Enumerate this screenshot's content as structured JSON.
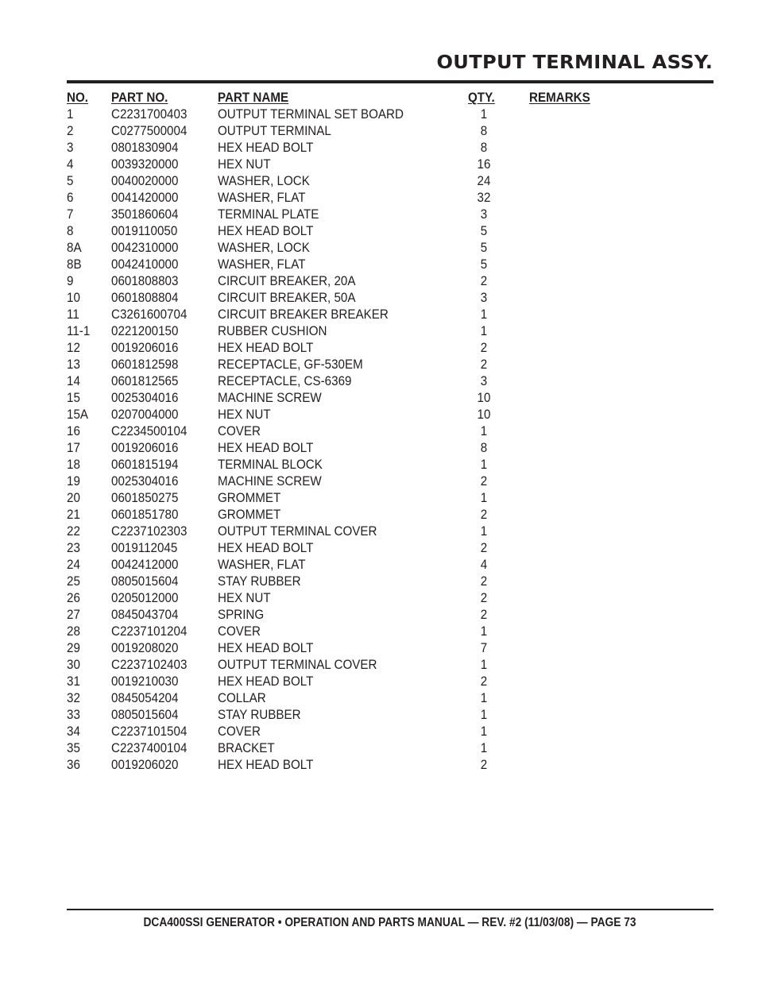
{
  "page": {
    "title": "OUTPUT TERMINAL ASSY.",
    "footer": "DCA400SSI GENERATOR • OPERATION AND PARTS MANUAL — REV. #2 (11/03/08) — PAGE 73"
  },
  "table": {
    "headers": {
      "no": "NO.",
      "part_no": "PART NO.",
      "part_name": "PART NAME",
      "qty": "QTY.",
      "remarks": "REMARKS"
    },
    "rows": [
      {
        "no": "1",
        "part_no": "C2231700403",
        "part_name": "OUTPUT TERMINAL SET BOARD",
        "qty": "1",
        "remarks": ""
      },
      {
        "no": "2",
        "part_no": "C0277500004",
        "part_name": "OUTPUT TERMINAL",
        "qty": "8",
        "remarks": ""
      },
      {
        "no": "3",
        "part_no": "0801830904",
        "part_name": "HEX HEAD BOLT",
        "qty": "8",
        "remarks": ""
      },
      {
        "no": "4",
        "part_no": "0039320000",
        "part_name": "HEX NUT",
        "qty": "16",
        "remarks": ""
      },
      {
        "no": "5",
        "part_no": "0040020000",
        "part_name": "WASHER, LOCK",
        "qty": "24",
        "remarks": ""
      },
      {
        "no": "6",
        "part_no": "0041420000",
        "part_name": "WASHER, FLAT",
        "qty": "32",
        "remarks": ""
      },
      {
        "no": "7",
        "part_no": "3501860604",
        "part_name": "TERMINAL PLATE",
        "qty": "3",
        "remarks": ""
      },
      {
        "no": "8",
        "part_no": "0019110050",
        "part_name": "HEX HEAD BOLT",
        "qty": "5",
        "remarks": ""
      },
      {
        "no": "8A",
        "part_no": "0042310000",
        "part_name": "WASHER, LOCK",
        "qty": "5",
        "remarks": ""
      },
      {
        "no": "8B",
        "part_no": "0042410000",
        "part_name": "WASHER, FLAT",
        "qty": "5",
        "remarks": ""
      },
      {
        "no": "9",
        "part_no": "0601808803",
        "part_name": "CIRCUIT BREAKER, 20A",
        "qty": "2",
        "remarks": ""
      },
      {
        "no": "10",
        "part_no": "0601808804",
        "part_name": "CIRCUIT BREAKER, 50A",
        "qty": "3",
        "remarks": ""
      },
      {
        "no": "11",
        "part_no": "C3261600704",
        "part_name": "CIRCUIT BREAKER BREAKER",
        "qty": "1",
        "remarks": ""
      },
      {
        "no": "11-1",
        "part_no": "0221200150",
        "part_name": "RUBBER CUSHION",
        "qty": "1",
        "remarks": ""
      },
      {
        "no": "12",
        "part_no": "0019206016",
        "part_name": "HEX HEAD BOLT",
        "qty": "2",
        "remarks": ""
      },
      {
        "no": "13",
        "part_no": "0601812598",
        "part_name": "RECEPTACLE, GF-530EM",
        "qty": "2",
        "remarks": ""
      },
      {
        "no": "14",
        "part_no": "0601812565",
        "part_name": "RECEPTACLE, CS-6369",
        "qty": "3",
        "remarks": ""
      },
      {
        "no": "15",
        "part_no": "0025304016",
        "part_name": "MACHINE SCREW",
        "qty": "10",
        "remarks": ""
      },
      {
        "no": "15A",
        "part_no": "0207004000",
        "part_name": "HEX NUT",
        "qty": "10",
        "remarks": ""
      },
      {
        "no": "16",
        "part_no": "C2234500104",
        "part_name": "COVER",
        "qty": "1",
        "remarks": ""
      },
      {
        "no": "17",
        "part_no": "0019206016",
        "part_name": "HEX HEAD BOLT",
        "qty": "8",
        "remarks": ""
      },
      {
        "no": "18",
        "part_no": "0601815194",
        "part_name": "TERMINAL BLOCK",
        "qty": "1",
        "remarks": ""
      },
      {
        "no": "19",
        "part_no": "0025304016",
        "part_name": "MACHINE SCREW",
        "qty": "2",
        "remarks": ""
      },
      {
        "no": "20",
        "part_no": "0601850275",
        "part_name": "GROMMET",
        "qty": "1",
        "remarks": ""
      },
      {
        "no": "21",
        "part_no": "0601851780",
        "part_name": "GROMMET",
        "qty": "2",
        "remarks": ""
      },
      {
        "no": "22",
        "part_no": "C2237102303",
        "part_name": "OUTPUT TERMINAL COVER",
        "qty": "1",
        "remarks": ""
      },
      {
        "no": "23",
        "part_no": "0019112045",
        "part_name": "HEX HEAD BOLT",
        "qty": "2",
        "remarks": ""
      },
      {
        "no": "24",
        "part_no": "0042412000",
        "part_name": "WASHER, FLAT",
        "qty": "4",
        "remarks": ""
      },
      {
        "no": "25",
        "part_no": "0805015604",
        "part_name": "STAY RUBBER",
        "qty": "2",
        "remarks": ""
      },
      {
        "no": "26",
        "part_no": "0205012000",
        "part_name": "HEX NUT",
        "qty": "2",
        "remarks": ""
      },
      {
        "no": "27",
        "part_no": "0845043704",
        "part_name": "SPRING",
        "qty": "2",
        "remarks": ""
      },
      {
        "no": "28",
        "part_no": "C2237101204",
        "part_name": "COVER",
        "qty": "1",
        "remarks": ""
      },
      {
        "no": "29",
        "part_no": "0019208020",
        "part_name": "HEX HEAD BOLT",
        "qty": "7",
        "remarks": ""
      },
      {
        "no": "30",
        "part_no": "C2237102403",
        "part_name": "OUTPUT TERMINAL COVER",
        "qty": "1",
        "remarks": ""
      },
      {
        "no": "31",
        "part_no": "0019210030",
        "part_name": "HEX HEAD BOLT",
        "qty": "2",
        "remarks": ""
      },
      {
        "no": "32",
        "part_no": "0845054204",
        "part_name": "COLLAR",
        "qty": "1",
        "remarks": ""
      },
      {
        "no": "33",
        "part_no": "0805015604",
        "part_name": "STAY RUBBER",
        "qty": "1",
        "remarks": ""
      },
      {
        "no": "34",
        "part_no": "C2237101504",
        "part_name": "COVER",
        "qty": "1",
        "remarks": ""
      },
      {
        "no": "35",
        "part_no": "C2237400104",
        "part_name": "BRACKET",
        "qty": "1",
        "remarks": ""
      },
      {
        "no": "36",
        "part_no": "0019206020",
        "part_name": "HEX HEAD BOLT",
        "qty": "2",
        "remarks": ""
      }
    ]
  }
}
